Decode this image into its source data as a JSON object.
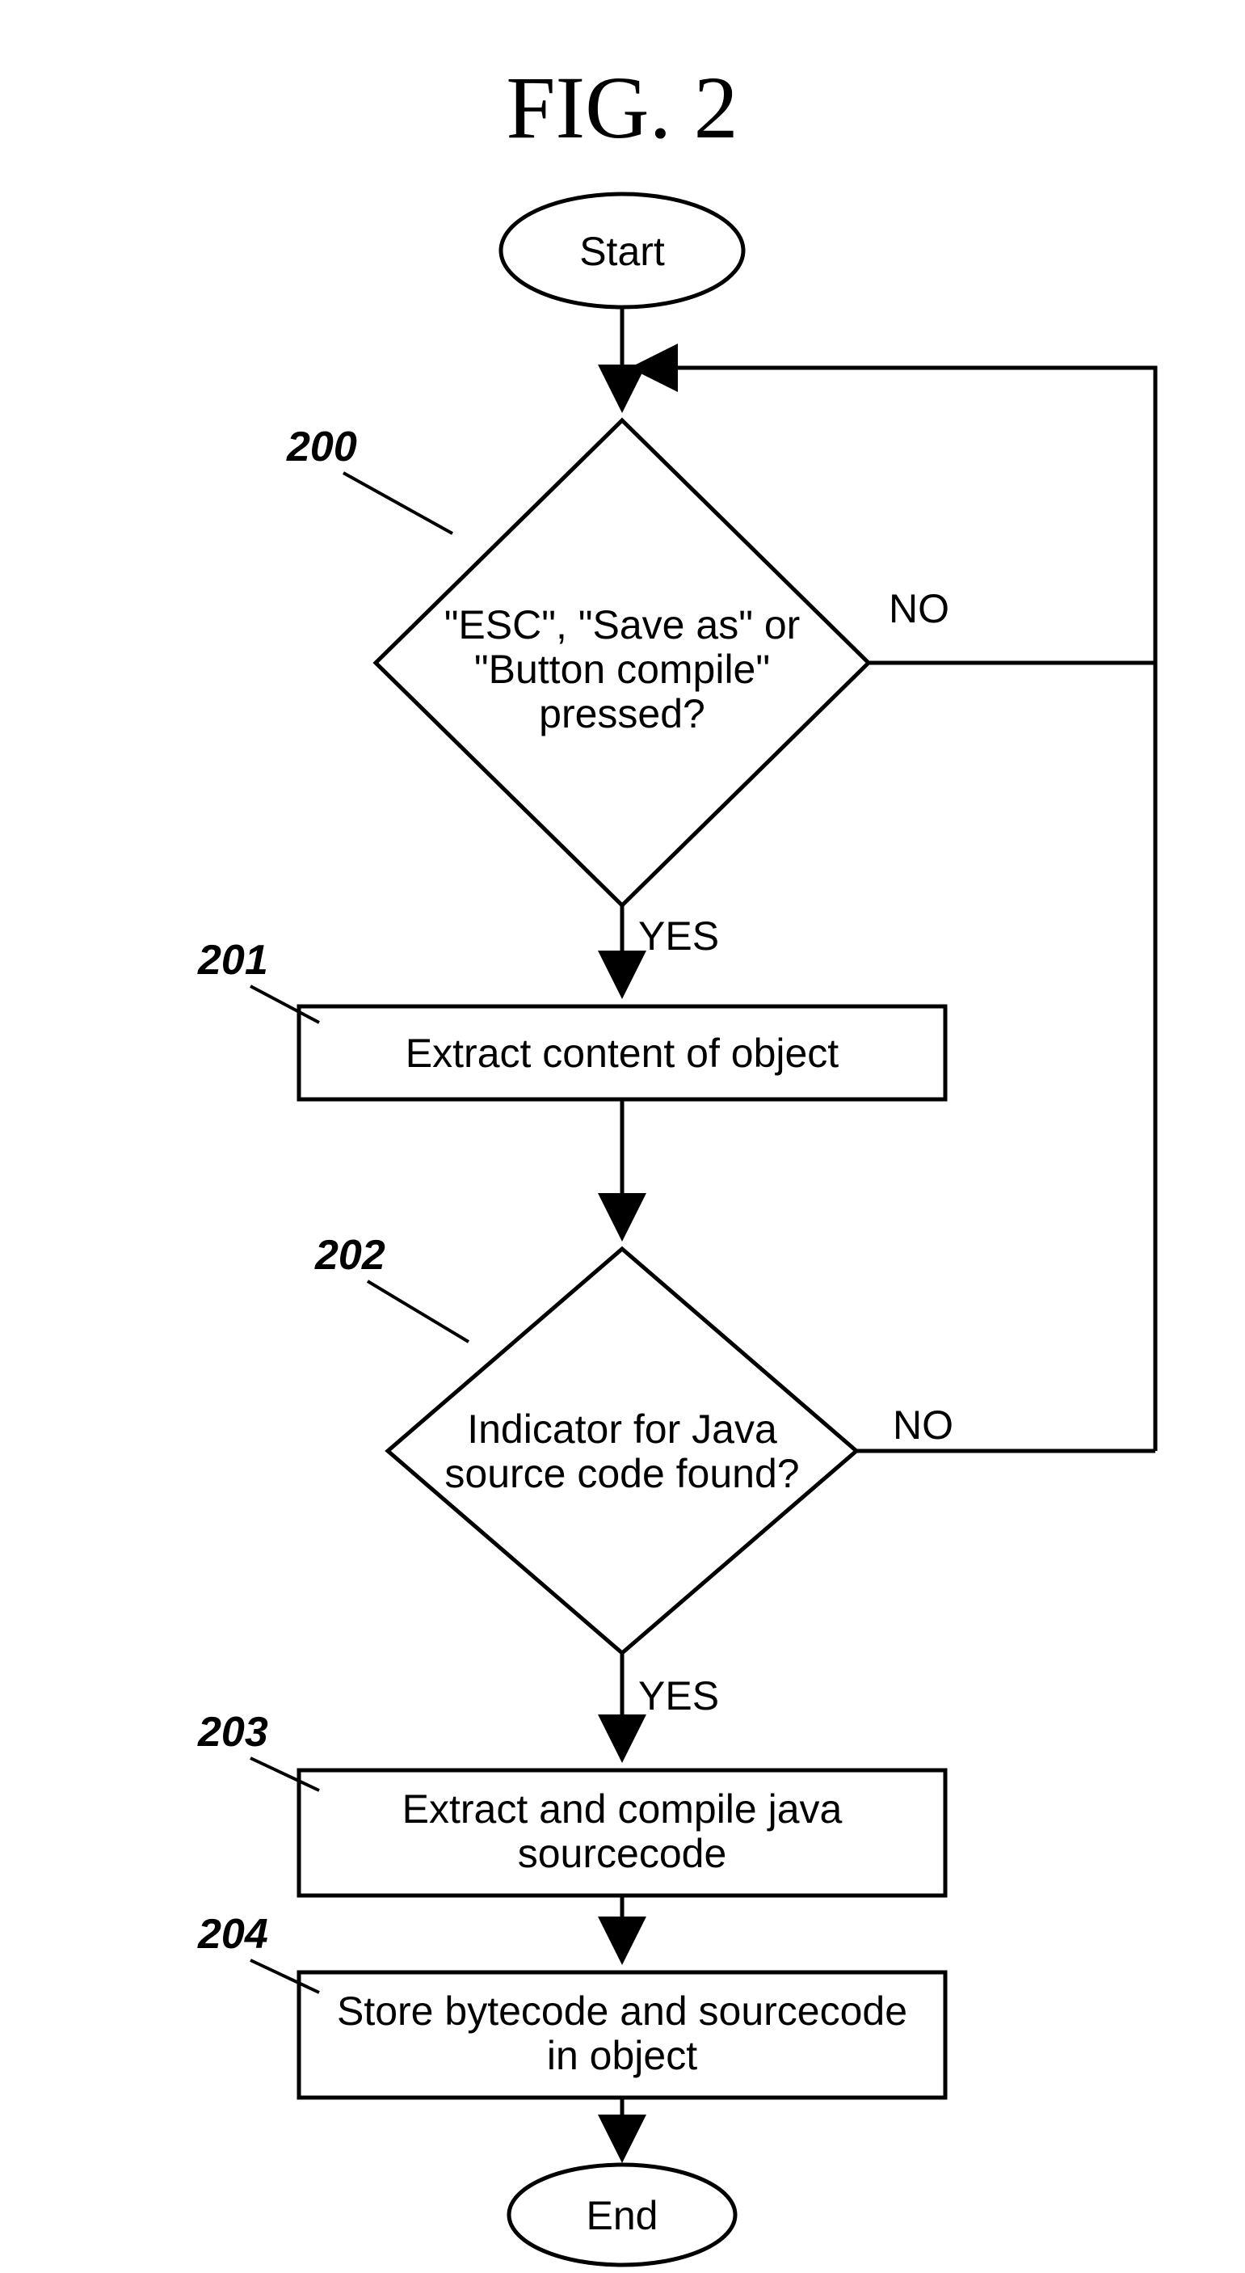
{
  "title": "FIG. 2",
  "nodes": {
    "start": "Start",
    "d200": {
      "l1": "\"ESC\", \"Save as\" or",
      "l2": "\"Button compile\"",
      "l3": "pressed?"
    },
    "p201": "Extract content of object",
    "d202": {
      "l1": "Indicator for Java",
      "l2": "source code found?"
    },
    "p203": {
      "l1": "Extract and compile java",
      "l2": "sourcecode"
    },
    "p204": {
      "l1": "Store bytecode and sourcecode",
      "l2": "in object"
    },
    "end": "End"
  },
  "labels": {
    "yes": "YES",
    "no": "NO"
  },
  "refs": {
    "r200": "200",
    "r201": "201",
    "r202": "202",
    "r203": "203",
    "r204": "204"
  }
}
